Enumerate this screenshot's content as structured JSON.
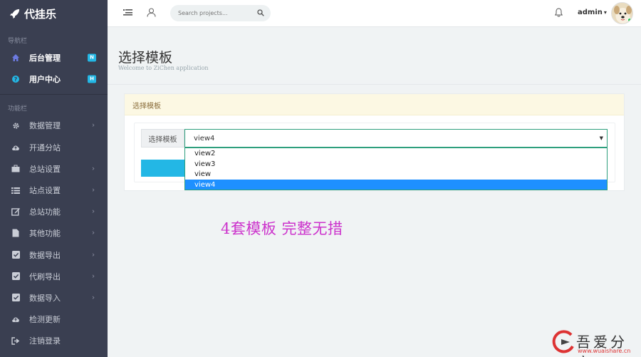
{
  "brand": {
    "name": "代挂乐"
  },
  "sidebar": {
    "section_nav": "导航栏",
    "section_func": "功能栏",
    "nav_items": [
      {
        "label": "后台管理",
        "badge": "N",
        "icon": "home-icon"
      },
      {
        "label": "用户中心",
        "badge": "H",
        "icon": "question-circle-icon"
      }
    ],
    "func_items": [
      {
        "label": "数据管理",
        "icon": "gear-icon",
        "chevron": true
      },
      {
        "label": "开通分站",
        "icon": "cloud-upload-icon",
        "chevron": false
      },
      {
        "label": "总站设置",
        "icon": "briefcase-icon",
        "chevron": true
      },
      {
        "label": "站点设置",
        "icon": "list-icon",
        "chevron": true
      },
      {
        "label": "总站功能",
        "icon": "edit-icon",
        "chevron": true
      },
      {
        "label": "其他功能",
        "icon": "file-icon",
        "chevron": true
      },
      {
        "label": "数据导出",
        "icon": "check-square-icon",
        "chevron": true
      },
      {
        "label": "代刷导出",
        "icon": "check-square-icon",
        "chevron": true
      },
      {
        "label": "数据导入",
        "icon": "check-square-icon",
        "chevron": true
      },
      {
        "label": "检测更新",
        "icon": "cloud-upload-icon",
        "chevron": false
      },
      {
        "label": "注销登录",
        "icon": "sign-out-icon",
        "chevron": false
      }
    ]
  },
  "header": {
    "search_placeholder": "Search projects...",
    "user_name": "admin"
  },
  "page": {
    "title": "选择模板",
    "subtitle": "Welcome to ZiChen application"
  },
  "panel": {
    "heading": "选择模板",
    "field_label": "选择模板",
    "selected_value": "view4",
    "options": [
      "view2",
      "view3",
      "view",
      "view4"
    ],
    "selected_index": 3
  },
  "promo": {
    "text": "4套模板  完整无措"
  },
  "watermark": {
    "text": "吾爱分享",
    "url": "www.wuaishare.cn"
  },
  "colors": {
    "sidebar_bg": "#3a3f51",
    "accent": "#23b7e5",
    "promo": "#cc33cc",
    "option_highlight": "#1e90ff"
  }
}
